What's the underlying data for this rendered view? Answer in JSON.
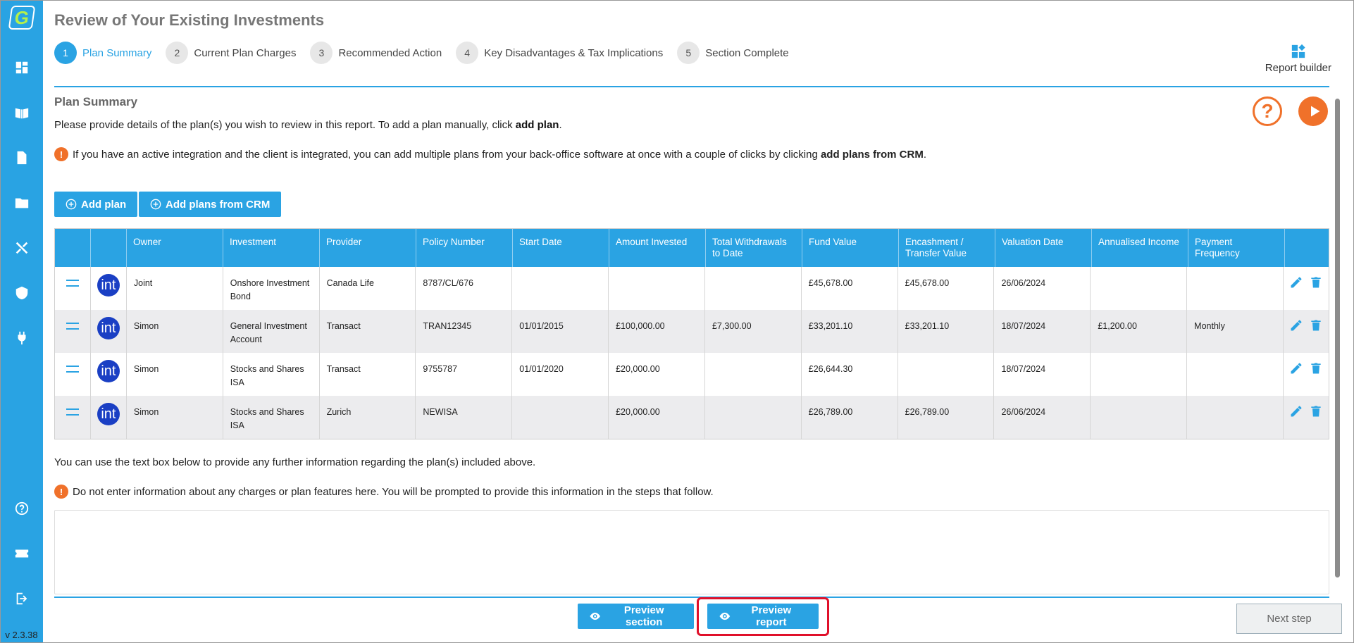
{
  "app": {
    "logo_letter": "G",
    "version": "v 2.3.38",
    "colors": {
      "primary": "#29a3e3",
      "accent": "#f0712a",
      "highlight": "#e0102a",
      "logo_green": "#b6f04a"
    }
  },
  "sidebar": {
    "icons_top": [
      "dashboard-icon",
      "book-icon",
      "document-icon",
      "folder-icon",
      "tools-icon",
      "shield-icon",
      "plug-icon"
    ],
    "icons_bottom": [
      "help-circle-icon",
      "ticket-icon",
      "logout-icon"
    ]
  },
  "header": {
    "title": "Review of Your Existing Investments",
    "steps": [
      {
        "num": "1",
        "label": "Plan Summary",
        "active": true
      },
      {
        "num": "2",
        "label": "Current Plan Charges",
        "active": false
      },
      {
        "num": "3",
        "label": "Recommended Action",
        "active": false
      },
      {
        "num": "4",
        "label": "Key Disadvantages & Tax Implications",
        "active": false
      },
      {
        "num": "5",
        "label": "Section Complete",
        "active": false
      }
    ],
    "report_builder_label": "Report builder"
  },
  "section": {
    "title": "Plan Summary",
    "help_glyph": "?",
    "intro_text": "Please provide details of the plan(s) you wish to review in this report. To add a plan manually, click ",
    "intro_bold": "add plan",
    "intro_end": ".",
    "info_icon_glyph": "!",
    "crm_info_text": "If you have an active integration and the client is integrated, you can add multiple plans from your back-office software at once with a couple of clicks by clicking ",
    "crm_info_bold": "add plans from CRM",
    "crm_info_end": ".",
    "add_plan_label": "Add plan",
    "add_plans_crm_label": "Add plans from CRM"
  },
  "table": {
    "columns": [
      "Owner",
      "Investment",
      "Provider",
      "Policy Number",
      "Start Date",
      "Amount Invested",
      "Total Withdrawals to Date",
      "Fund Value",
      "Encashment / Transfer Value",
      "Valuation Date",
      "Annualised Income",
      "Payment Frequency"
    ],
    "logo_text": "int",
    "rows": [
      {
        "owner": "Joint",
        "investment": "Onshore Investment Bond",
        "provider": "Canada Life",
        "policy": "8787/CL/676",
        "start": "",
        "invested": "",
        "withdrawals": "",
        "fund": "£45,678.00",
        "encashment": "£45,678.00",
        "valuation": "26/06/2024",
        "income": "",
        "frequency": ""
      },
      {
        "owner": "Simon",
        "investment": "General Investment Account",
        "provider": "Transact",
        "policy": "TRAN12345",
        "start": "01/01/2015",
        "invested": "£100,000.00",
        "withdrawals": "£7,300.00",
        "fund": "£33,201.10",
        "encashment": "£33,201.10",
        "valuation": "18/07/2024",
        "income": "£1,200.00",
        "frequency": "Monthly"
      },
      {
        "owner": "Simon",
        "investment": "Stocks and Shares ISA",
        "provider": "Transact",
        "policy": "9755787",
        "start": "01/01/2020",
        "invested": "£20,000.00",
        "withdrawals": "",
        "fund": "£26,644.30",
        "encashment": "",
        "valuation": "18/07/2024",
        "income": "",
        "frequency": ""
      },
      {
        "owner": "Simon",
        "investment": "Stocks and Shares ISA",
        "provider": "Zurich",
        "policy": "NEWISA",
        "start": "",
        "invested": "£20,000.00",
        "withdrawals": "",
        "fund": "£26,789.00",
        "encashment": "£26,789.00",
        "valuation": "26/06/2024",
        "income": "",
        "frequency": ""
      }
    ]
  },
  "notes": {
    "further_info_text": "You can use the text box below to provide any further information regarding the plan(s) included above.",
    "warning_text": "Do not enter information about any charges or plan features here. You will be prompted to provide this information in the steps that follow.",
    "textbox_value": ""
  },
  "footer": {
    "preview_section_label": "Preview section",
    "preview_report_label": "Preview report",
    "next_step_label": "Next step"
  }
}
